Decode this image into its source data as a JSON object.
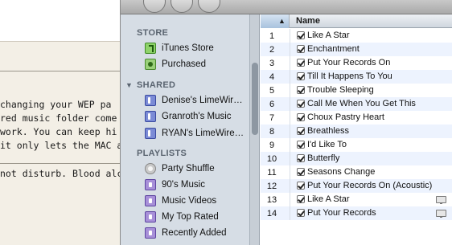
{
  "background_document": {
    "lines": [
      "changing your WEP pa",
      "red music folder come",
      "work. You can keep hi",
      " it only lets the MAC a",
      "not disturb. Blood alc"
    ]
  },
  "sidebar": {
    "sections": [
      {
        "heading": "STORE",
        "items": [
          {
            "label": "iTunes Store",
            "icon": "itunes-store-icon"
          },
          {
            "label": "Purchased",
            "icon": "purchased-icon"
          }
        ]
      },
      {
        "heading": "SHARED",
        "disclosure": "▼",
        "items": [
          {
            "label": "Denise's LimeWir…",
            "icon": "shared-library-icon"
          },
          {
            "label": "Granroth's Music",
            "icon": "shared-library-icon"
          },
          {
            "label": "RYAN's LimeWire…",
            "icon": "shared-library-icon"
          }
        ]
      },
      {
        "heading": "PLAYLISTS",
        "items": [
          {
            "label": "Party Shuffle",
            "icon": "party-shuffle-icon"
          },
          {
            "label": "90's Music",
            "icon": "smart-playlist-icon"
          },
          {
            "label": "Music Videos",
            "icon": "smart-playlist-icon"
          },
          {
            "label": "My Top Rated",
            "icon": "smart-playlist-icon"
          },
          {
            "label": "Recently Added",
            "icon": "smart-playlist-icon"
          }
        ]
      }
    ]
  },
  "track_list": {
    "sort_arrow": "▲",
    "column_name": "Name",
    "rows": [
      {
        "num": "1",
        "name": "Like A Star",
        "checked": true,
        "video": false
      },
      {
        "num": "2",
        "name": "Enchantment",
        "checked": true,
        "video": false
      },
      {
        "num": "3",
        "name": "Put Your Records On",
        "checked": true,
        "video": false
      },
      {
        "num": "4",
        "name": "Till It Happens To You",
        "checked": true,
        "video": false
      },
      {
        "num": "5",
        "name": "Trouble Sleeping",
        "checked": true,
        "video": false
      },
      {
        "num": "6",
        "name": "Call Me When You Get This",
        "checked": true,
        "video": false
      },
      {
        "num": "7",
        "name": "Choux Pastry Heart",
        "checked": true,
        "video": false
      },
      {
        "num": "8",
        "name": "Breathless",
        "checked": true,
        "video": false
      },
      {
        "num": "9",
        "name": "I'd Like To",
        "checked": true,
        "video": false
      },
      {
        "num": "10",
        "name": "Butterfly",
        "checked": true,
        "video": false
      },
      {
        "num": "11",
        "name": "Seasons Change",
        "checked": true,
        "video": false
      },
      {
        "num": "12",
        "name": "Put Your Records On (Acoustic)",
        "checked": true,
        "video": false
      },
      {
        "num": "13",
        "name": "Like A Star",
        "checked": true,
        "video": true
      },
      {
        "num": "14",
        "name": "Put Your Records",
        "checked": true,
        "video": true
      }
    ]
  }
}
